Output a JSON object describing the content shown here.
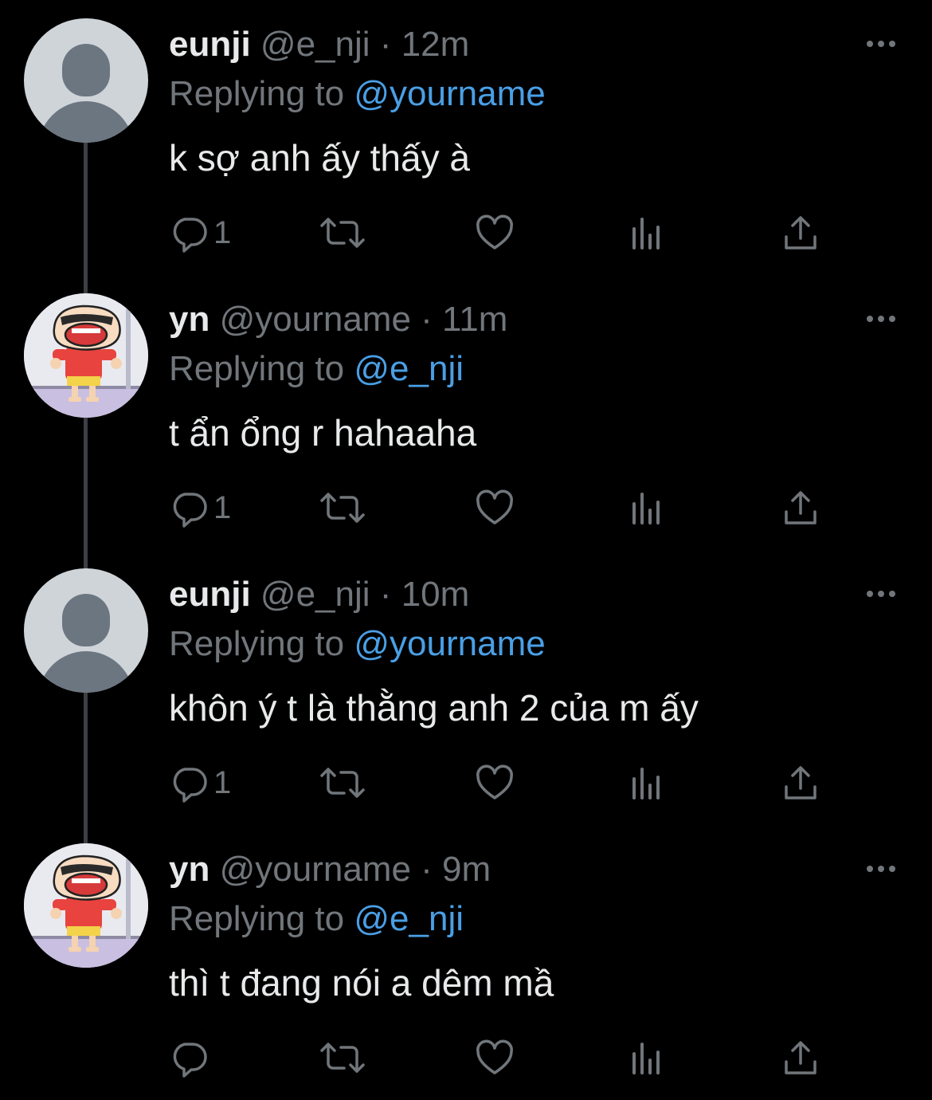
{
  "colors": {
    "background": "#000000",
    "text_primary": "#e7e9ea",
    "text_secondary": "#71767b",
    "mention": "#4a9fe5",
    "thread_line": "#3d3f45"
  },
  "tweets": [
    {
      "name": "eunji",
      "handle": "@e_nji",
      "separator": "·",
      "time": "12m",
      "replying_prefix": "Replying to",
      "replying_to": "@yourname",
      "text": "k sợ anh ấy thấy à",
      "avatar": "default-avatar",
      "reply_count": "1"
    },
    {
      "name": "yn",
      "handle": "@yourname",
      "separator": "·",
      "time": "11m",
      "replying_prefix": "Replying to",
      "replying_to": "@e_nji",
      "text": "t ẩn ổng r hahaaha",
      "avatar": "cartoon-avatar",
      "reply_count": "1"
    },
    {
      "name": "eunji",
      "handle": "@e_nji",
      "separator": "·",
      "time": "10m",
      "replying_prefix": "Replying to",
      "replying_to": "@yourname",
      "text": "khôn ý t là thằng anh 2 của m ấy",
      "avatar": "default-avatar",
      "reply_count": "1"
    },
    {
      "name": "yn",
      "handle": "@yourname",
      "separator": "·",
      "time": "9m",
      "replying_prefix": "Replying to",
      "replying_to": "@e_nji",
      "text": "thì t đang nói a dêm mầ",
      "avatar": "cartoon-avatar",
      "reply_count": ""
    }
  ],
  "icons": {
    "more": "more-horizontal-icon",
    "reply": "reply-icon",
    "retweet": "retweet-icon",
    "like": "heart-icon",
    "views": "analytics-icon",
    "share": "share-icon"
  }
}
